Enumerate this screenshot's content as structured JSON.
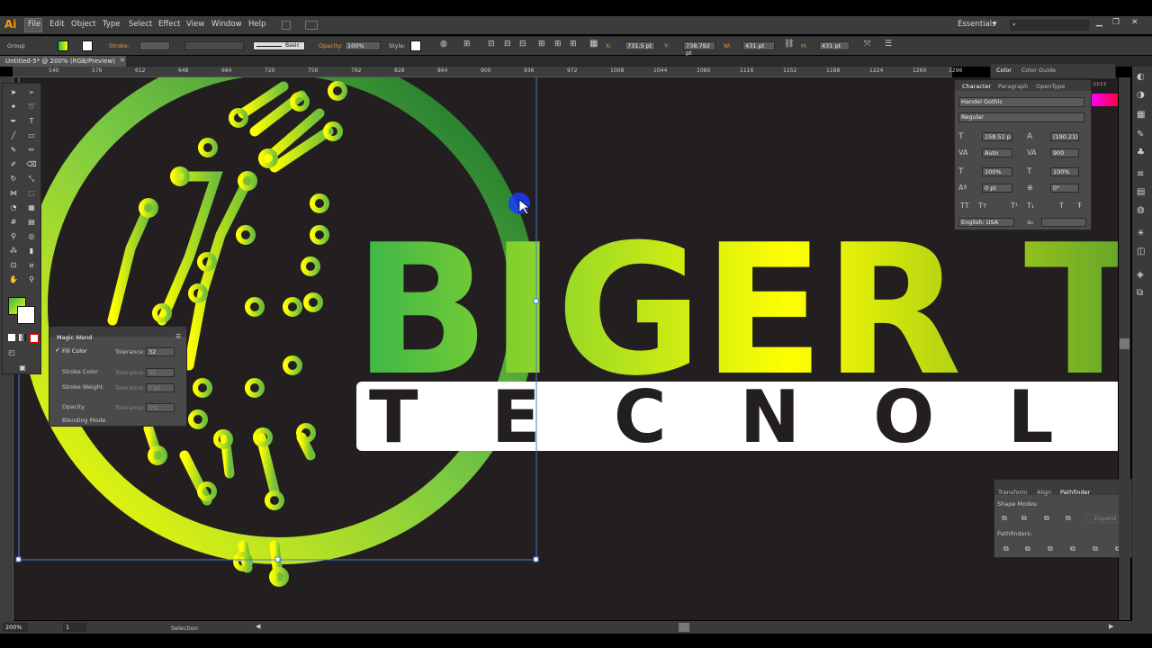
{
  "app": {
    "logo": "Ai"
  },
  "menu": [
    "File",
    "Edit",
    "Object",
    "Type",
    "Select",
    "Effect",
    "View",
    "Window",
    "Help"
  ],
  "workspace": {
    "name": "Essentials"
  },
  "control_bar": {
    "selection_label": "Group",
    "stroke_label": "Stroke:",
    "brush_label": "Basic",
    "opacity_label": "Opacity:",
    "opacity_value": "100%",
    "style_label": "Style:",
    "x_value": "731.5 pt",
    "y_value": "738.792 pt",
    "w_value": "431 pt",
    "h_value": "431 pt"
  },
  "document": {
    "tab_title": "Untitled-5* @ 200% (RGB/Preview)"
  },
  "ruler_ticks": [
    "540",
    "576",
    "612",
    "648",
    "684",
    "720",
    "756",
    "792",
    "828",
    "864",
    "900",
    "936",
    "972",
    "1008",
    "1044",
    "1080",
    "1116",
    "1152",
    "1188",
    "1224",
    "1260",
    "1296"
  ],
  "artwork": {
    "headline": "BIGER T",
    "subline": "T E C N O L O",
    "accent_colors": [
      "#3ab54a",
      "#ffff00",
      "#1a7a30",
      "#7ac943"
    ]
  },
  "magic_wand": {
    "title": "Magic Wand",
    "rows": [
      {
        "label": "Fill Color",
        "checked": true,
        "tolerance_label": "Tolerance:",
        "tolerance": "32"
      },
      {
        "label": "Stroke Color",
        "checked": false,
        "tolerance_label": "Tolerance:",
        "tolerance": "32"
      },
      {
        "label": "Stroke Weight",
        "checked": false,
        "tolerance_label": "Tolerance:",
        "tolerance": "5 pt"
      },
      {
        "label": "Opacity",
        "checked": false,
        "tolerance_label": "Tolerance:",
        "tolerance": "5%"
      },
      {
        "label": "Blending Mode",
        "checked": false
      }
    ]
  },
  "color_panel": {
    "tabs": [
      "Color",
      "Color Guide"
    ],
    "hex": "FFFF"
  },
  "character_panel": {
    "tabs": [
      "Character",
      "Paragraph",
      "OpenType"
    ],
    "font_family": "Handel Gothic",
    "font_style": "Regular",
    "size": "158.51 p",
    "leading": "(190.21)",
    "kerning": "Auto",
    "tracking": "900",
    "vscale": "100%",
    "hscale": "100%",
    "baseline": "0 pt",
    "rotation": "0°",
    "language": "English: USA"
  },
  "pathfinder_panel": {
    "tabs": [
      "Transform",
      "Align",
      "Pathfinder"
    ],
    "shape_modes_label": "Shape Modes:",
    "expand_label": "Expand",
    "pathfinders_label": "Pathfinders:"
  },
  "status": {
    "zoom": "200%",
    "page": "1",
    "tool": "Selection"
  }
}
